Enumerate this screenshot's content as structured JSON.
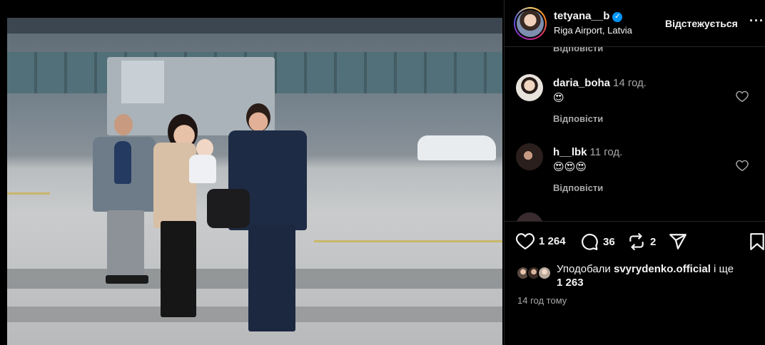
{
  "post": {
    "username": "tetyana__b",
    "location": "Riga Airport, Latvia",
    "follow_label": "Відстежується",
    "more_label": "···",
    "verified_mark": "✓",
    "photo_subject": ""
  },
  "comments": {
    "cut_reply_label": "Відповісти",
    "items": [
      {
        "user": "daria_boha",
        "time": "14 год.",
        "emoji": "😍",
        "reply": "Відповісти",
        "avatar_color": "#e9e3de"
      },
      {
        "user": "h__lbk",
        "time": "11 год.",
        "emoji": "😍😍😍",
        "reply": "Відповісти",
        "avatar_color": "#2a1f1c"
      }
    ]
  },
  "actions": {
    "likes": "1 264",
    "comments": "36",
    "reposts": "2"
  },
  "likes_summary": {
    "prefix": "Уподобали",
    "top_user": "svyrydenko.official",
    "suffix": "і ще",
    "count": "1 263"
  },
  "timestamp": "14 год тому",
  "colors": {
    "accent_blue": "#0095f6",
    "text_primary": "#f5f5f5",
    "text_secondary": "#a8a8a8",
    "border": "#262626"
  }
}
